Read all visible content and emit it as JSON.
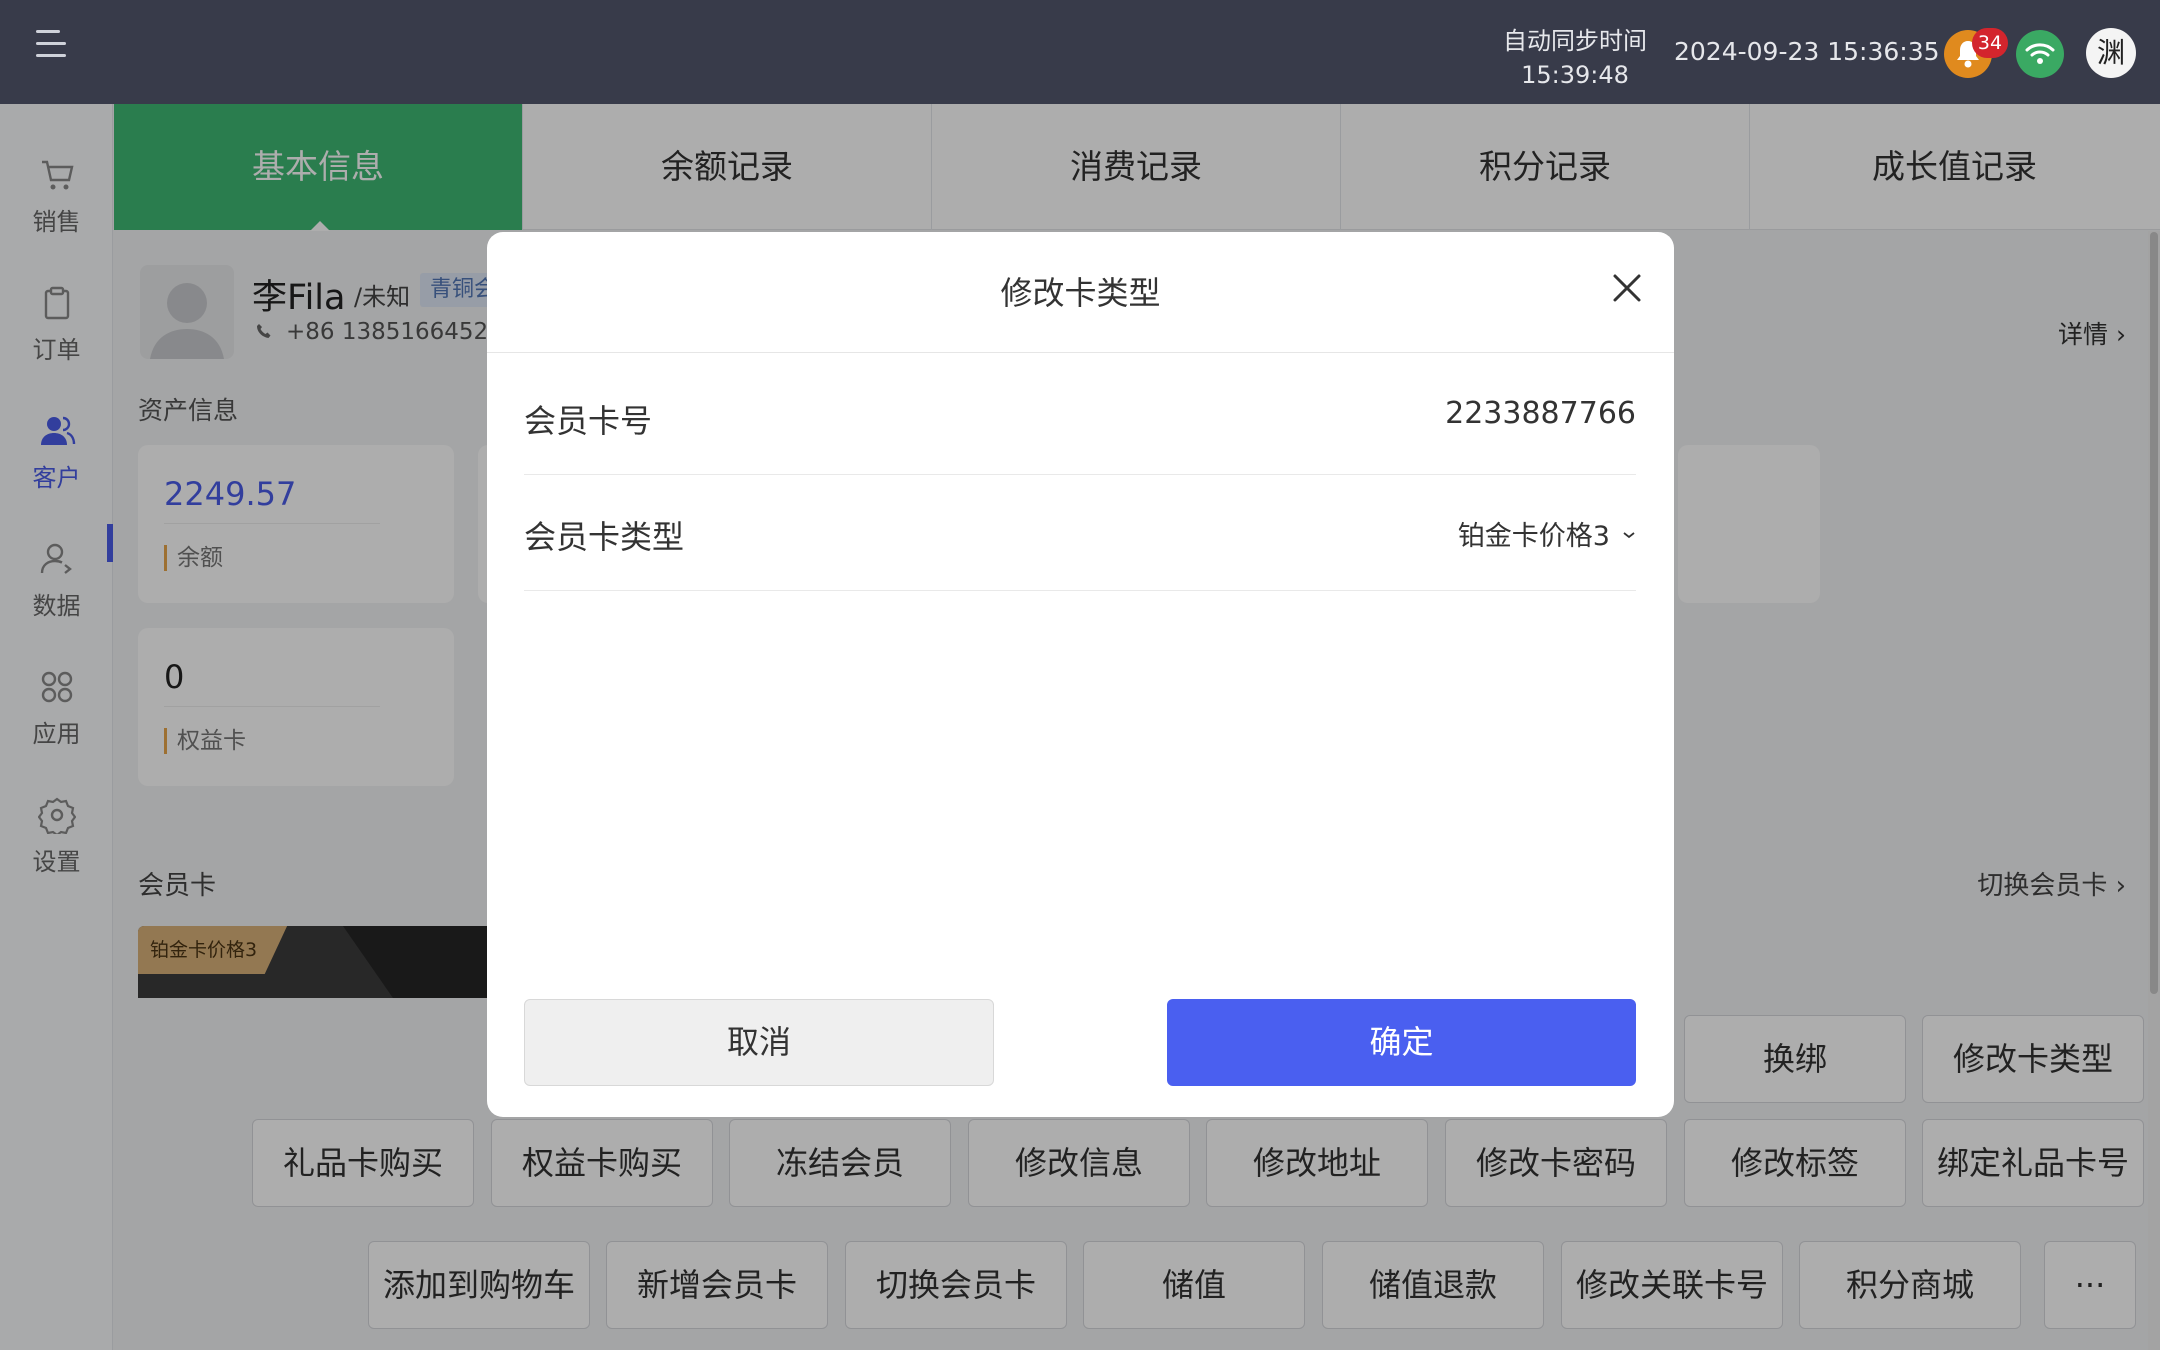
{
  "topbar": {
    "sync_label": "自动同步时间",
    "sync_time": "15:39:48",
    "datetime": "2024-09-23 15:36:35",
    "notification_count": "34",
    "avatar_text": "渊"
  },
  "sidebar": {
    "items": [
      {
        "label": "销售",
        "icon": "cart-icon"
      },
      {
        "label": "订单",
        "icon": "clipboard-icon"
      },
      {
        "label": "客户",
        "icon": "users-icon",
        "active": true
      },
      {
        "label": "数据",
        "icon": "user-data-icon"
      },
      {
        "label": "应用",
        "icon": "apps-icon"
      },
      {
        "label": "设置",
        "icon": "gear-icon"
      }
    ]
  },
  "tabs": [
    "基本信息",
    "余额记录",
    "消费记录",
    "积分记录",
    "成长值记录"
  ],
  "profile": {
    "name": "李Fila",
    "gender": "/未知",
    "level": "青铜会",
    "phone": "+86 13851664527",
    "detail_link": "详情 ›"
  },
  "assets": {
    "title": "资产信息",
    "balance_value": "2249.57",
    "balance_label": "余额",
    "rights_value": "0",
    "rights_label": "权益卡"
  },
  "member_card": {
    "title": "会员卡",
    "switch_link": "切换会员卡 ›",
    "card_type": "铂金卡价格3"
  },
  "actions": {
    "row1": [
      "换绑",
      "修改卡类型"
    ],
    "row2": [
      "礼品卡购买",
      "权益卡购买",
      "冻结会员",
      "修改信息",
      "修改地址",
      "修改卡密码",
      "修改标签",
      "绑定礼品卡号"
    ],
    "row3": [
      "添加到购物车",
      "新增会员卡",
      "切换会员卡",
      "储值",
      "储值退款",
      "修改关联卡号",
      "积分商城",
      "···"
    ]
  },
  "modal": {
    "title": "修改卡类型",
    "card_no_label": "会员卡号",
    "card_no_value": "2233887766",
    "card_type_label": "会员卡类型",
    "card_type_value": "铂金卡价格3",
    "cancel_label": "取消",
    "ok_label": "确定"
  },
  "colors": {
    "accent": "#4a5ff0",
    "tab_active": "#3fb873",
    "topbar": "#383b4a"
  }
}
